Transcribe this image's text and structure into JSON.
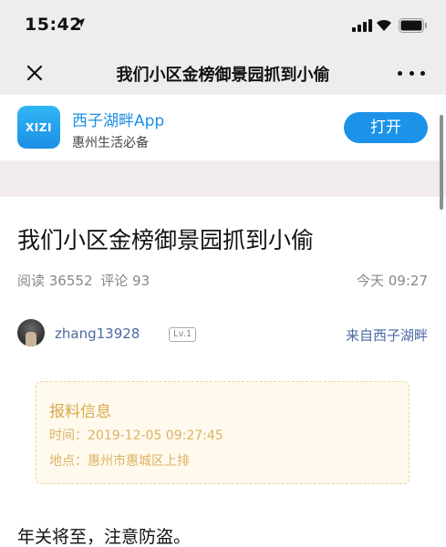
{
  "status_bar": {
    "time": "15:42"
  },
  "nav": {
    "title": "我们小区金榜御景园抓到小偷"
  },
  "app_banner": {
    "logo_text": "XIZI",
    "name": "西子湖畔App",
    "subtitle": "惠州生活必备",
    "open_label": "打开",
    "accent": "#1c93e8"
  },
  "article": {
    "title": "我们小区金榜御景园抓到小偷",
    "reads": "阅读 36552",
    "comments": "评论 93",
    "time": "今天 09:27",
    "author": "zhang13928",
    "level": "Lv.1",
    "source": "来自西子湖畔",
    "report": {
      "heading": "报料信息",
      "time_line": "时间：2019-12-05 09:27:45",
      "place_line": "地点：惠州市惠城区上排"
    },
    "body": "年关将至，注意防盗。"
  },
  "icons": {
    "close": "close-icon",
    "more": "more-icon",
    "location": "location-arrow-icon",
    "signal": "cellular-signal-icon",
    "wifi": "wifi-icon",
    "battery": "battery-icon"
  }
}
